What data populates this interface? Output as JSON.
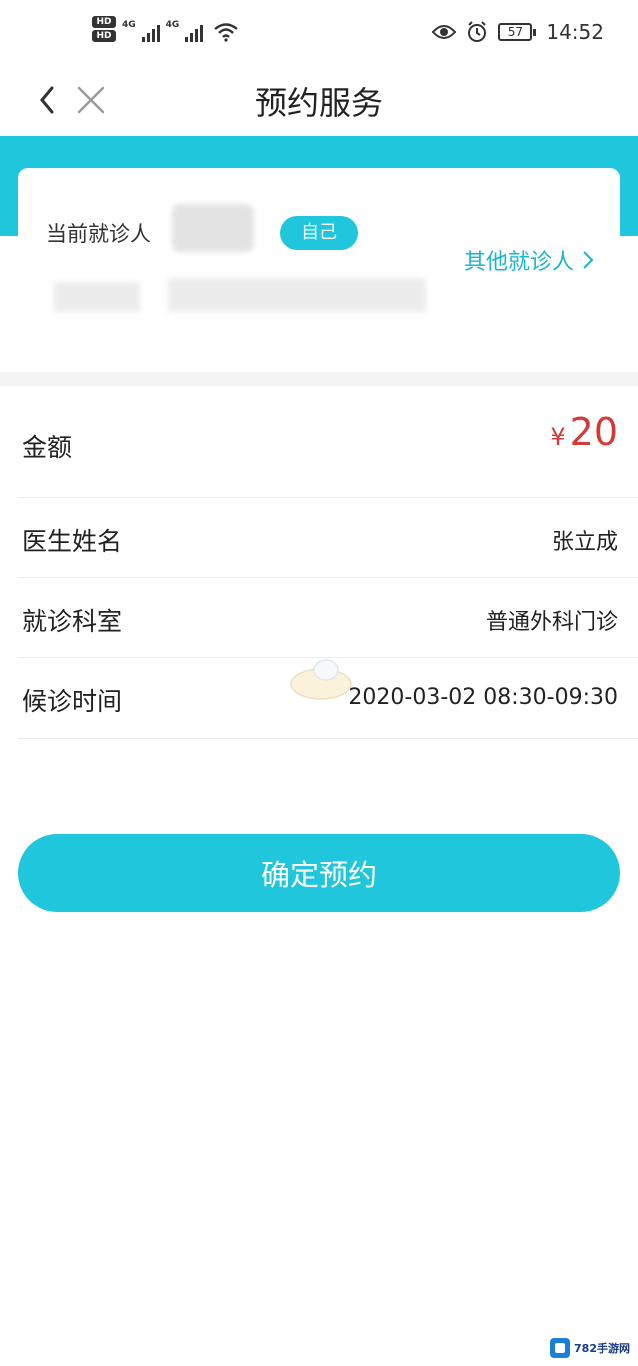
{
  "status_bar": {
    "hd_1": "HD",
    "hd_2": "HD",
    "network_1": "4G",
    "network_2": "4G",
    "battery_level": "57",
    "time": "14:52"
  },
  "nav": {
    "title": "预约服务"
  },
  "patient": {
    "current_label": "当前就诊人",
    "relation_badge": "自己",
    "other_patients_link": "其他就诊人"
  },
  "appointment": {
    "amount_label": "金额",
    "currency_symbol": "¥",
    "amount": "20",
    "doctor_label": "医生姓名",
    "doctor_name": "张立成",
    "department_label": "就诊科室",
    "department": "普通外科门诊",
    "time_label": "候诊时间",
    "time_value": "2020-03-02 08:30-09:30"
  },
  "actions": {
    "confirm_label": "确定预约"
  },
  "watermark": {
    "text": "782手游网"
  },
  "colors": {
    "accent": "#1fc6dc",
    "price": "#d33a3a",
    "link": "#19b6cc"
  },
  "icons": [
    "back-chevron-icon",
    "close-icon",
    "eye-icon",
    "alarm-icon",
    "wifi-icon",
    "signal-icon",
    "battery-icon",
    "chevron-right-icon"
  ]
}
